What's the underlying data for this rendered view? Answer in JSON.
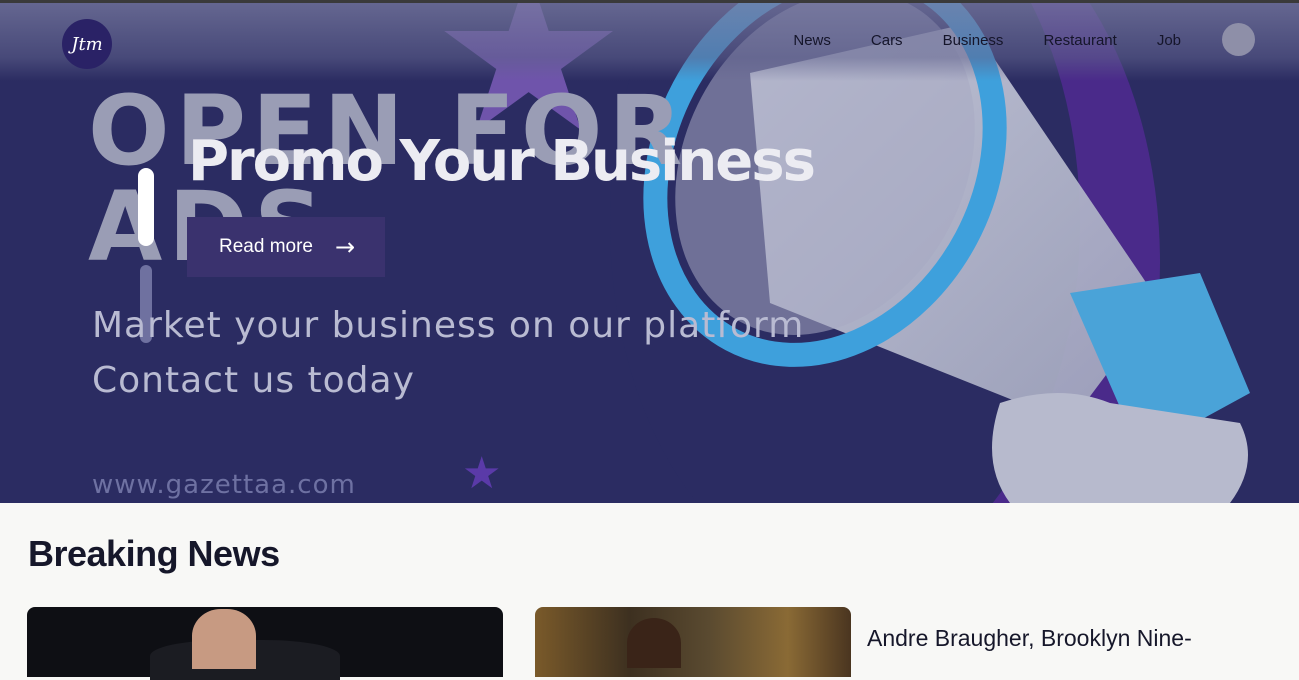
{
  "nav": {
    "logo_text": "Jtm",
    "links": [
      "News",
      "Cars",
      "Business",
      "Restaurant",
      "Job"
    ]
  },
  "hero": {
    "background_text": "OPEN FOR ADS",
    "title": "Promo Your Business",
    "read_more_label": "Read more",
    "line1": "Market your business on our platform",
    "line2": "Contact us today",
    "url": "www.gazettaa.com",
    "colors": {
      "hero_bg": "#2b2c62",
      "accent": "#4a9fd8",
      "button_bg": "#3a326e"
    }
  },
  "breaking": {
    "title": "Breaking News",
    "headline": "Andre Braugher, Brooklyn Nine-"
  }
}
